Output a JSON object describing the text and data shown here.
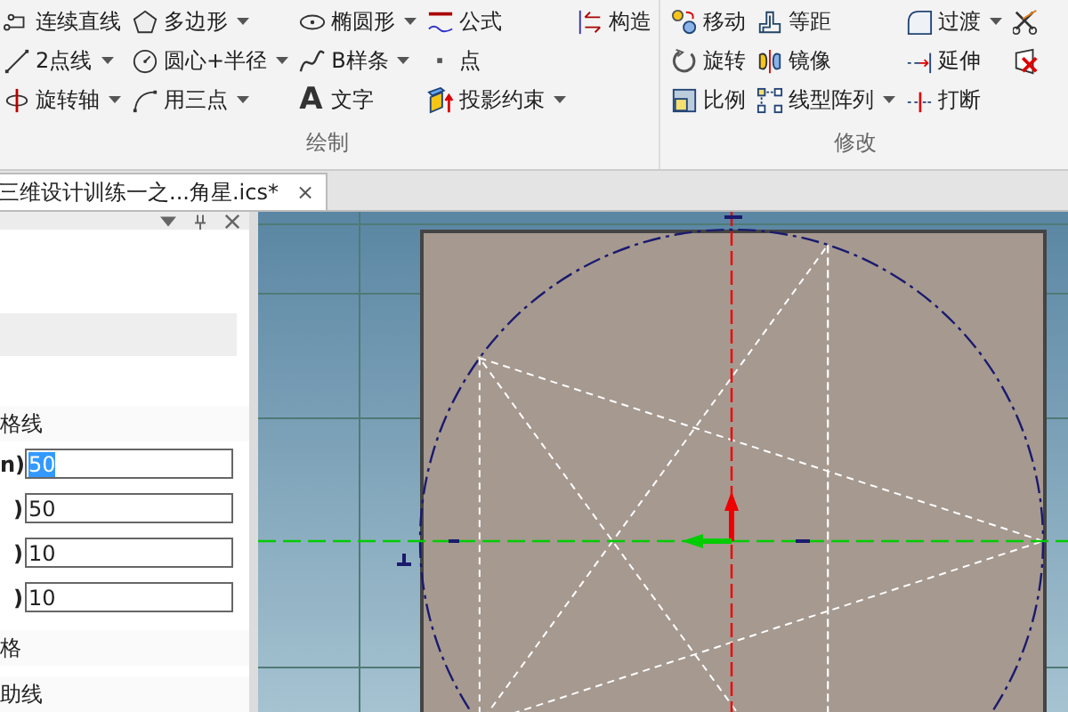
{
  "ribbon": {
    "groups": [
      {
        "label": "绘制",
        "rows": [
          [
            {
              "label": "连续直线",
              "dropdown": false
            },
            {
              "label": "多边形",
              "dropdown": true
            },
            {
              "label": "椭圆形",
              "dropdown": true
            },
            {
              "label": "公式",
              "dropdown": false
            },
            {
              "label": "构造",
              "dropdown": false
            }
          ],
          [
            {
              "label": "2点线",
              "dropdown": true
            },
            {
              "label": "圆心+半径",
              "dropdown": true
            },
            {
              "label": "B样条",
              "dropdown": true
            },
            {
              "label": "点",
              "dropdown": false
            }
          ],
          [
            {
              "label": "旋转轴",
              "dropdown": true
            },
            {
              "label": "用三点",
              "dropdown": true
            },
            {
              "label": "文字",
              "glyph": "A",
              "dropdown": false
            },
            {
              "label": "投影约束",
              "dropdown": true
            }
          ]
        ]
      },
      {
        "label": "修改",
        "rows": [
          [
            {
              "label": "移动",
              "dropdown": false
            },
            {
              "label": "等距",
              "dropdown": false
            },
            {
              "label": "过渡",
              "dropdown": true
            },
            {
              "dropdown": false
            }
          ],
          [
            {
              "label": "旋转",
              "dropdown": false
            },
            {
              "label": "镜像",
              "dropdown": false
            },
            {
              "label": "延伸",
              "dropdown": false
            },
            {
              "dropdown": false
            }
          ],
          [
            {
              "label": "比例",
              "dropdown": false
            },
            {
              "label": "线型阵列",
              "dropdown": true
            },
            {
              "label": "打断",
              "dropdown": false
            }
          ]
        ]
      }
    ]
  },
  "document_tab": {
    "title": "三维设计训练一之...角星.ics*",
    "close": "×",
    "selected": true
  },
  "property_panel": {
    "sections": [
      {
        "title": "格线",
        "fields": [
          {
            "label": "n)",
            "value": "50",
            "selected": true
          },
          {
            "label": ")",
            "value": "50",
            "selected": false
          },
          {
            "label": ")",
            "value": "10",
            "selected": false
          },
          {
            "label": ")",
            "value": "10",
            "selected": false
          }
        ]
      },
      {
        "title": "格"
      },
      {
        "title": "助线"
      }
    ]
  }
}
